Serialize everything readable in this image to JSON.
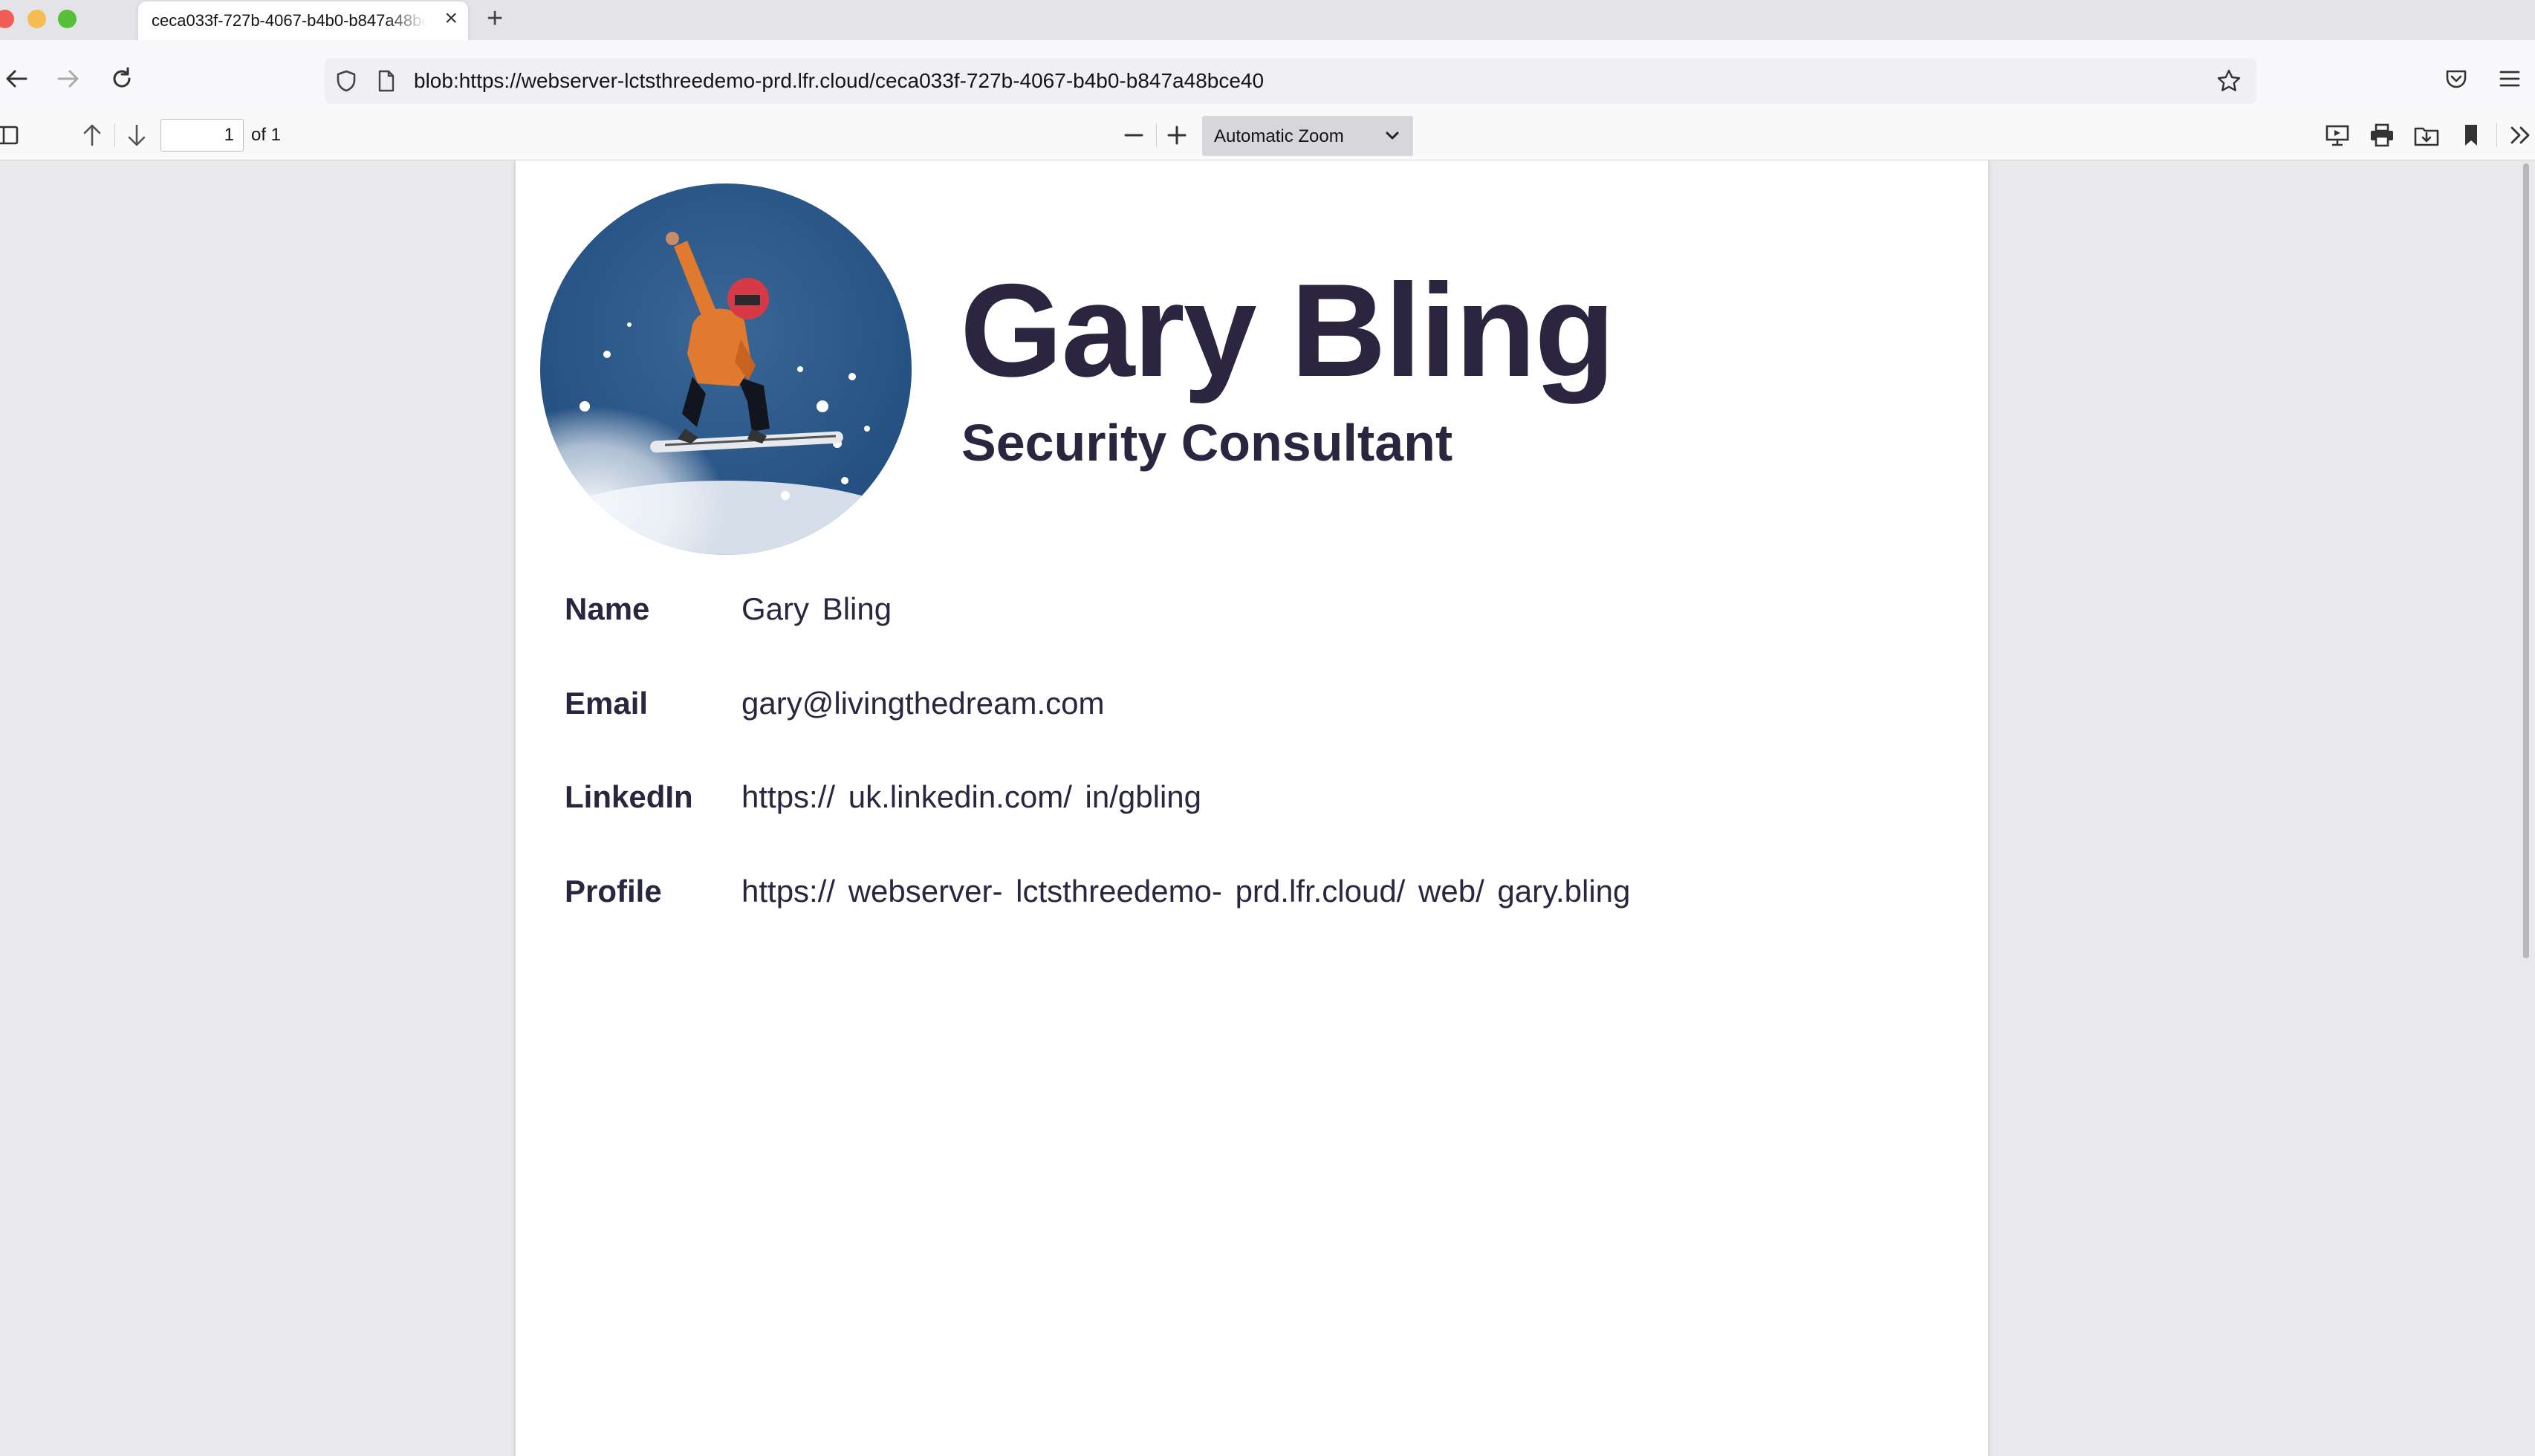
{
  "browser": {
    "tab_title": "ceca033f-727b-4067-b4b0-b847a48bce40",
    "address": "blob:https://webserver-lctsthreedemo-prd.lfr.cloud/ceca033f-727b-4067-b4b0-b847a48bce40",
    "icons": {
      "back": "back-arrow-icon",
      "forward": "forward-arrow-icon",
      "reload": "reload-icon",
      "shield": "tracking-protection-icon",
      "page": "page-info-icon",
      "bookmark_star": "star-icon",
      "pocket": "pocket-icon",
      "menu": "hamburger-menu-icon"
    }
  },
  "pdf_toolbar": {
    "page_number": "1",
    "page_count": "of 1",
    "zoom": "Automatic Zoom",
    "icons": [
      "sidebar-toggle-icon",
      "previous-page-icon",
      "next-page-icon",
      "zoom-out-icon",
      "zoom-in-icon",
      "presentation-mode-icon",
      "print-icon",
      "save-icon",
      "bookmark-icon",
      "tools-icon"
    ]
  },
  "document": {
    "name": "Gary Bling",
    "role": "Security  Consultant",
    "fields": [
      {
        "label": "Name",
        "value": "Gary  Bling"
      },
      {
        "label": "Email",
        "value": "gary@livingthedream.com"
      },
      {
        "label": "LinkedIn",
        "value": "https://  uk.linkedin.com/   in/gbling"
      },
      {
        "label": "Profile",
        "value": "https://  webserver-  lctsthreedemo-   prd.lfr.cloud/   web/ gary.bling"
      }
    ]
  },
  "colors": {
    "heading": "#2b2540",
    "chrome_bg": "#e3e3e8",
    "viewer_bg": "#e9e9ec"
  }
}
